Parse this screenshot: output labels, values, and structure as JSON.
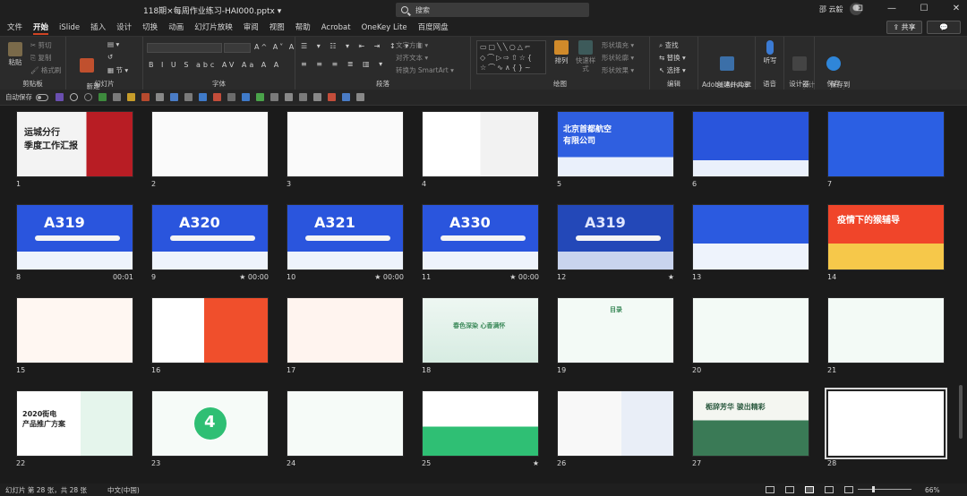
{
  "window": {
    "doc_title": "118期×每周作业练习-HAI000.pptx ▾",
    "search_placeholder": "搜索",
    "user_name": "邵 云毅",
    "min": "—",
    "max": "☐",
    "close": "✕",
    "ribbon_display": "⊡"
  },
  "tabs": [
    "文件",
    "开始",
    "iSlide",
    "插入",
    "设计",
    "切换",
    "动画",
    "幻灯片放映",
    "审阅",
    "视图",
    "帮助",
    "Acrobat",
    "OneKey Lite",
    "百度网盘"
  ],
  "active_tab": "开始",
  "share_label": "共享",
  "ribbon": {
    "clipboard": {
      "paste": "粘贴",
      "cut": "剪切",
      "copy": "复制",
      "format": "格式刷",
      "label": "剪贴板"
    },
    "slides": {
      "new_slide": "新建\n幻灯片 ▾",
      "layout": "▤ ▾",
      "reset": "↺",
      "section": "▦ 节 ▾",
      "label": "幻灯片"
    },
    "font": {
      "label": "字体",
      "glyphs": "B I U S abc AV Aa A A",
      "grow": "A^ A˅ A"
    },
    "paragraph": {
      "text_dir": "文字方向 ▾",
      "align_text": "对齐文本 ▾",
      "smartart": "转换为 SmartArt ▾",
      "label": "段落"
    },
    "drawing": {
      "arrange": "排列",
      "quick_styles": "快速样式",
      "fill": "形状填充 ▾",
      "outline": "形状轮廓 ▾",
      "effects": "形状效果 ▾",
      "label": "绘图"
    },
    "editing": {
      "find": "查找",
      "replace": "替换 ▾",
      "select": "选择 ▾",
      "label": "编辑"
    },
    "acrobat": {
      "create_share": "创建并共享\nAdobe PDF",
      "label": "Adobe Acrobat"
    },
    "voice": {
      "dictate": "听写",
      "label": "语音"
    },
    "designer": {
      "ideas": "设计\n灵感",
      "label": "设计器"
    },
    "save": {
      "save_to": "保存到\n百度网盘",
      "label": "保存"
    }
  },
  "qat": {
    "autosave": "自动保存",
    "toggle_state": "关"
  },
  "slides": [
    {
      "n": "1",
      "dur": "",
      "title": "运城分行\n季度工作汇报",
      "theme": "redcard"
    },
    {
      "n": "2",
      "dur": "",
      "title": "",
      "theme": "whitered"
    },
    {
      "n": "3",
      "dur": "",
      "title": "",
      "theme": "whitered2"
    },
    {
      "n": "4",
      "dur": "",
      "title": "",
      "theme": "whitered3"
    },
    {
      "n": "5",
      "dur": "",
      "title": "北京首都航空\n有限公司",
      "theme": "blue"
    },
    {
      "n": "6",
      "dur": "",
      "title": "",
      "theme": "bluetower"
    },
    {
      "n": "7",
      "dur": "",
      "title": "",
      "theme": "bluetable"
    },
    {
      "n": "8",
      "dur": "00:01",
      "title": "A319",
      "theme": "bluejet"
    },
    {
      "n": "9",
      "dur": "★ 00:00",
      "title": "A320",
      "theme": "bluejet"
    },
    {
      "n": "10",
      "dur": "★ 00:00",
      "title": "A321",
      "theme": "bluejet"
    },
    {
      "n": "11",
      "dur": "★ 00:00",
      "title": "A330",
      "theme": "bluejet"
    },
    {
      "n": "12",
      "dur": "★",
      "title": "A319",
      "theme": "bluejetdark"
    },
    {
      "n": "13",
      "dur": "",
      "title": "",
      "theme": "bluecards"
    },
    {
      "n": "14",
      "dur": "",
      "title": "疫情下的猴辅导",
      "theme": "orange"
    },
    {
      "n": "15",
      "dur": "",
      "title": "",
      "theme": "whiteorange"
    },
    {
      "n": "16",
      "dur": "",
      "title": "",
      "theme": "orangebook"
    },
    {
      "n": "17",
      "dur": "",
      "title": "",
      "theme": "orangemap"
    },
    {
      "n": "18",
      "dur": "",
      "title": "春色深染 心香满怀",
      "theme": "mint"
    },
    {
      "n": "19",
      "dur": "",
      "title": "目录",
      "theme": "mintlist"
    },
    {
      "n": "20",
      "dur": "",
      "title": "",
      "theme": "mintlist2"
    },
    {
      "n": "21",
      "dur": "",
      "title": "",
      "theme": "mintlist3"
    },
    {
      "n": "22",
      "dur": "",
      "title": "2020街电\n产品推广方案",
      "theme": "green"
    },
    {
      "n": "23",
      "dur": "",
      "title": "4",
      "theme": "greencircle"
    },
    {
      "n": "24",
      "dur": "",
      "title": "",
      "theme": "greenhex"
    },
    {
      "n": "25",
      "dur": "★",
      "title": "",
      "theme": "greenmod"
    },
    {
      "n": "26",
      "dur": "",
      "title": "",
      "theme": "ink"
    },
    {
      "n": "27",
      "dur": "",
      "title": "栀辞芳华 骏出精彩",
      "theme": "hills"
    },
    {
      "n": "28",
      "dur": "",
      "title": "",
      "theme": "panda"
    }
  ],
  "status": {
    "slide_count": "幻灯片 第 28 张，共 28 张",
    "language": "中文(中国)",
    "zoom": "66%"
  }
}
